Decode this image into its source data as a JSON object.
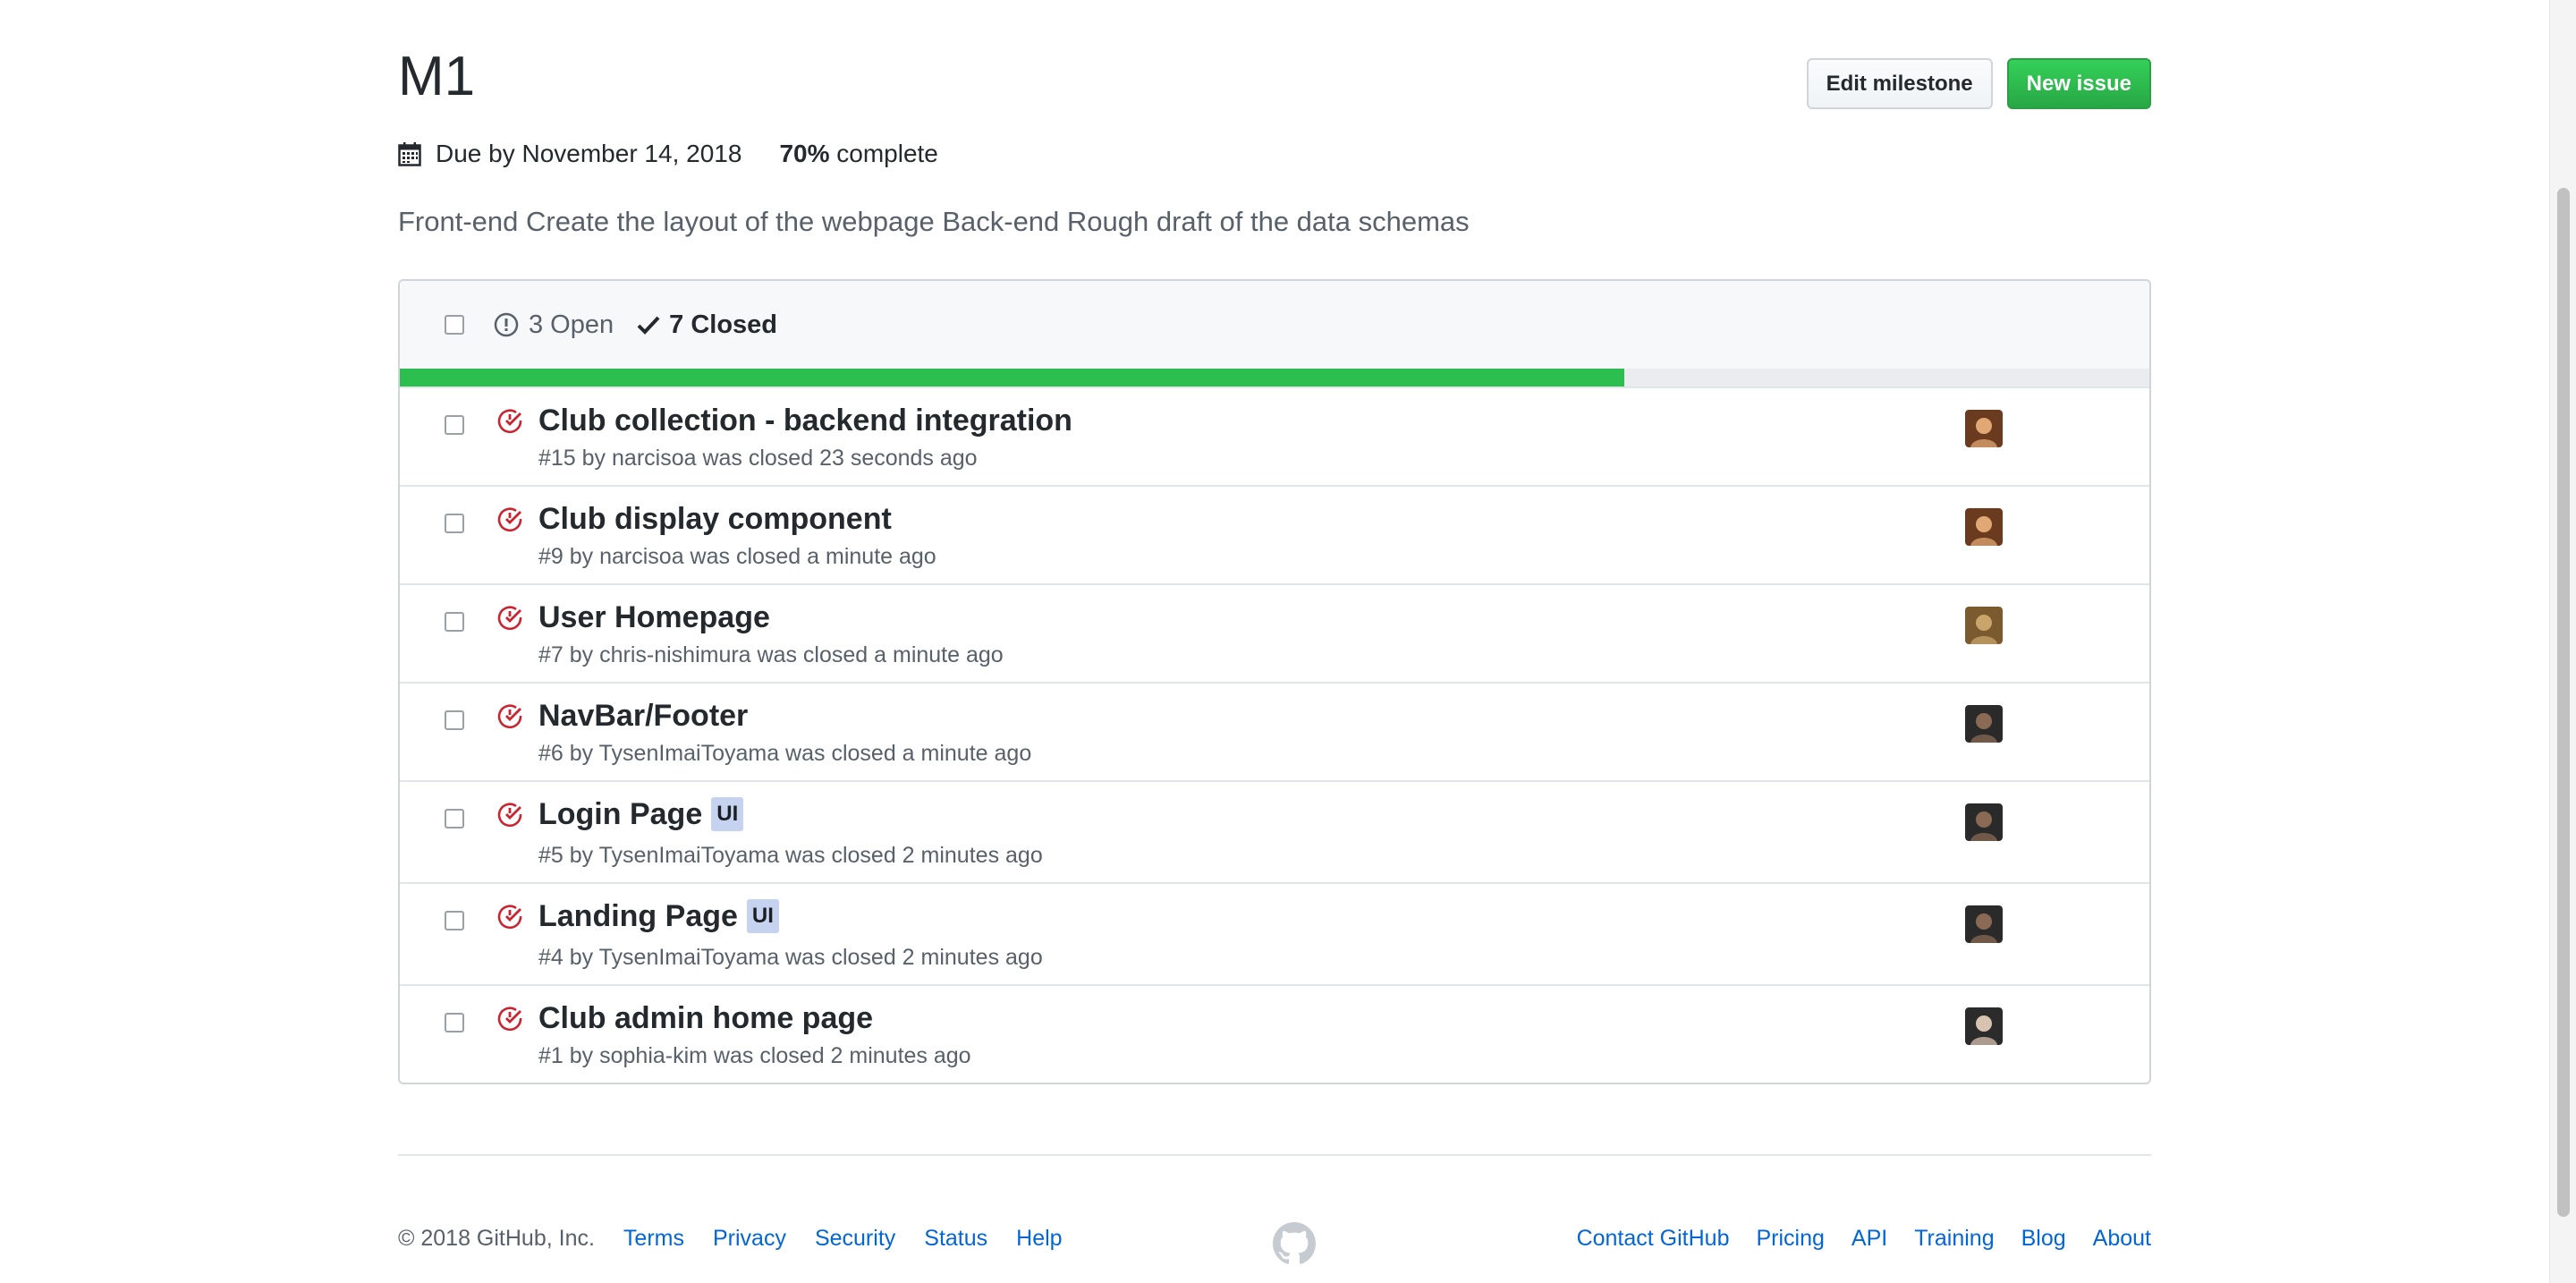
{
  "milestone": {
    "title": "M1",
    "due": "Due by November 14, 2018",
    "percent": "70%",
    "percent_suffix": "complete",
    "description": "Front-end Create the layout of the webpage Back-end Rough draft of the data schemas",
    "progress_fraction": 0.7
  },
  "actions": {
    "edit_label": "Edit milestone",
    "new_issue_label": "New issue"
  },
  "states": {
    "open_label": "3 Open",
    "closed_label": "7 Closed"
  },
  "issues": [
    {
      "title": "Club collection - backend integration",
      "label": "",
      "meta": "#15 by narcisoa was closed 23 seconds ago"
    },
    {
      "title": "Club display component",
      "label": "",
      "meta": "#9 by narcisoa was closed a minute ago"
    },
    {
      "title": "User Homepage",
      "label": "",
      "meta": "#7 by chris-nishimura was closed a minute ago"
    },
    {
      "title": "NavBar/Footer",
      "label": "",
      "meta": "#6 by TysenImaiToyama was closed a minute ago"
    },
    {
      "title": "Login Page",
      "label": "UI",
      "meta": "#5 by TysenImaiToyama was closed 2 minutes ago"
    },
    {
      "title": "Landing Page",
      "label": "UI",
      "meta": "#4 by TysenImaiToyama was closed 2 minutes ago"
    },
    {
      "title": "Club admin home page",
      "label": "",
      "meta": "#1 by sophia-kim was closed 2 minutes ago"
    }
  ],
  "footer": {
    "copyright": "© 2018 GitHub, Inc.",
    "left_links": [
      "Terms",
      "Privacy",
      "Security",
      "Status",
      "Help"
    ],
    "right_links": [
      "Contact GitHub",
      "Pricing",
      "API",
      "Training",
      "Blog",
      "About"
    ]
  },
  "colors": {
    "closed_icon": "#cb2431",
    "progress": "#2cbe4e",
    "primary_button": "#28a745",
    "link": "#0366d6",
    "label_ui": "#c5d3f0"
  },
  "icons": {
    "due": "calendar-icon",
    "open": "issue-opened-icon",
    "closed": "check-icon",
    "issue_closed": "issue-closed-icon",
    "footer_mark": "github-mark-icon"
  }
}
